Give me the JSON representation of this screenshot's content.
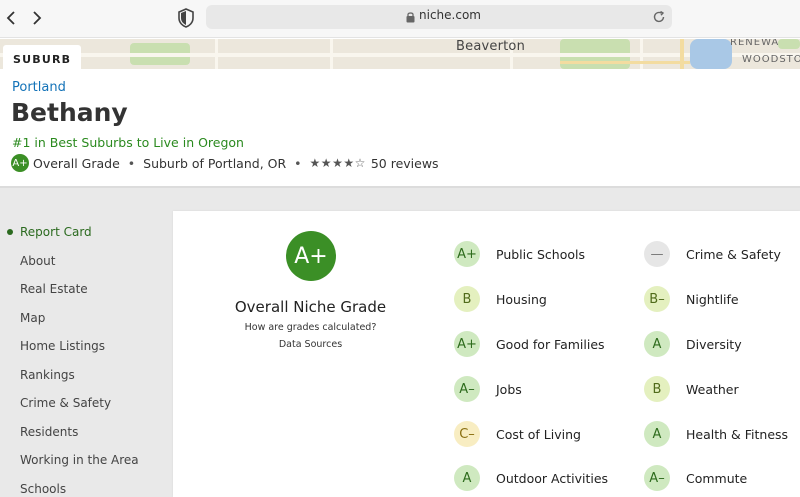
{
  "browser": {
    "url": "niche.com"
  },
  "map": {
    "city_label": "Beaverton",
    "edge_labels": [
      "RENEWA",
      "WOODSTO"
    ],
    "tag": "SUBURB"
  },
  "header": {
    "breadcrumb": "Portland",
    "title": "Bethany",
    "rank": "#1 in Best Suburbs to Live in Oregon",
    "overall_grade": "A+",
    "overall_grade_label": "Overall Grade",
    "location": "Suburb of Portland, OR",
    "stars": "★★★★☆",
    "reviews": "50 reviews"
  },
  "sidebar": {
    "items": [
      "Report Card",
      "About",
      "Real Estate",
      "Map",
      "Home Listings",
      "Rankings",
      "Crime & Safety",
      "Residents",
      "Working in the Area",
      "Schools"
    ]
  },
  "report": {
    "grade": "A+",
    "title": "Overall Niche Grade",
    "how_link": "How are grades calculated?",
    "sources_link": "Data Sources",
    "grades": [
      {
        "label": "Public Schools",
        "grade": "A+"
      },
      {
        "label": "Housing",
        "grade": "B"
      },
      {
        "label": "Good for Families",
        "grade": "A+"
      },
      {
        "label": "Jobs",
        "grade": "A–"
      },
      {
        "label": "Cost of Living",
        "grade": "C–"
      },
      {
        "label": "Outdoor Activities",
        "grade": "A"
      },
      {
        "label": "Crime & Safety",
        "grade": "—"
      },
      {
        "label": "Nightlife",
        "grade": "B–"
      },
      {
        "label": "Diversity",
        "grade": "A"
      },
      {
        "label": "Weather",
        "grade": "B"
      },
      {
        "label": "Health & Fitness",
        "grade": "A"
      },
      {
        "label": "Commute",
        "grade": "A–"
      }
    ]
  },
  "colors": {
    "brand_green": "#3b8f26",
    "link_blue": "#1473b8"
  }
}
